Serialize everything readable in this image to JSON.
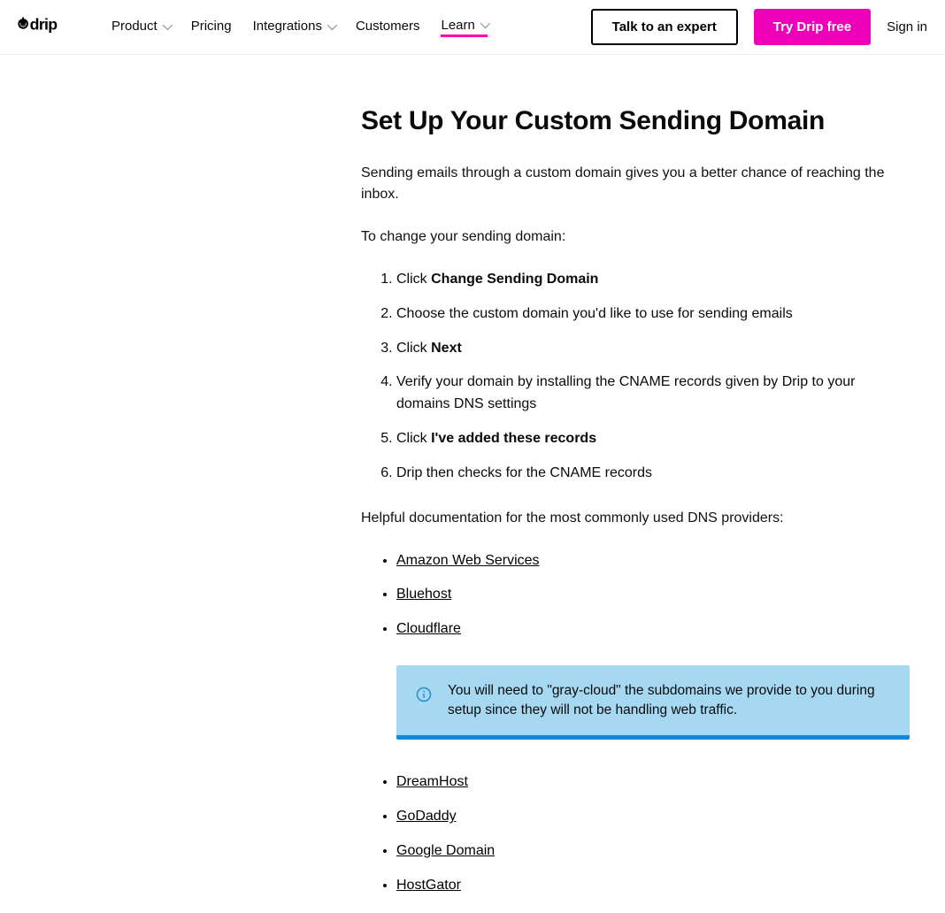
{
  "nav": {
    "product": "Product",
    "pricing": "Pricing",
    "integrations": "Integrations",
    "customers": "Customers",
    "learn": "Learn"
  },
  "actions": {
    "talk": "Talk to an expert",
    "try": "Try Drip free",
    "signin": "Sign in"
  },
  "article": {
    "title": "Set Up Your Custom Sending Domain",
    "intro": "Sending emails through a custom domain gives you a better chance of reaching the inbox.",
    "lead": "To change your sending domain:",
    "steps": {
      "s1a": "Click ",
      "s1b": "Change Sending Domain",
      "s2": "Choose the custom domain you'd like to use for sending emails",
      "s3a": "Click ",
      "s3b": "Next",
      "s4": "Verify your domain by installing the CNAME records given by Drip to your domains DNS settings",
      "s5a": "Click ",
      "s5b": "I've added these records",
      "s6": "Drip then checks for the CNAME records"
    },
    "helpful": "Helpful documentation for the most commonly used DNS providers:",
    "providers1": {
      "aws": "Amazon Web Services",
      "bluehost": "Bluehost",
      "cloudflare": "Cloudflare"
    },
    "callout": "You will need to \"gray-cloud\" the subdomains we provide to you during setup since they will not be handling web traffic.",
    "providers2": {
      "dreamhost": "DreamHost",
      "godaddy": "GoDaddy",
      "google": "Google Domain",
      "hostgator": "HostGator"
    }
  }
}
